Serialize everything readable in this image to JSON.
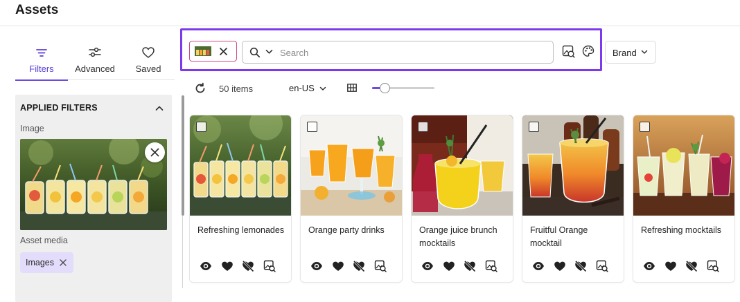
{
  "header": {
    "title": "Assets"
  },
  "sidebar": {
    "tabs": [
      {
        "label": "Filters",
        "icon": "filter-lines-icon",
        "active": true
      },
      {
        "label": "Advanced",
        "icon": "sliders-icon",
        "active": false
      },
      {
        "label": "Saved",
        "icon": "heart-outline-icon",
        "active": false
      }
    ],
    "applied_filters": {
      "header": "APPLIED FILTERS",
      "image_label": "Image",
      "media_label": "Asset media",
      "media_chip": "Images"
    }
  },
  "search": {
    "placeholder": "Search",
    "value": "",
    "brand_label": "Brand"
  },
  "toolbar": {
    "items_count": "50 items",
    "locale": "en-US",
    "thumbnail_size": 0.2
  },
  "assets": [
    {
      "title": "Refreshing lemonades"
    },
    {
      "title": "Orange party drinks"
    },
    {
      "title": "Orange juice brunch mocktails"
    },
    {
      "title": "Fruitful Orange mocktail"
    },
    {
      "title": "Refreshing mocktails"
    }
  ],
  "colors": {
    "accent": "#6d4be0",
    "highlight_frame": "#7c3aed",
    "chip_bg": "#e4dcfb",
    "image_chip_border": "#d04a8a"
  }
}
